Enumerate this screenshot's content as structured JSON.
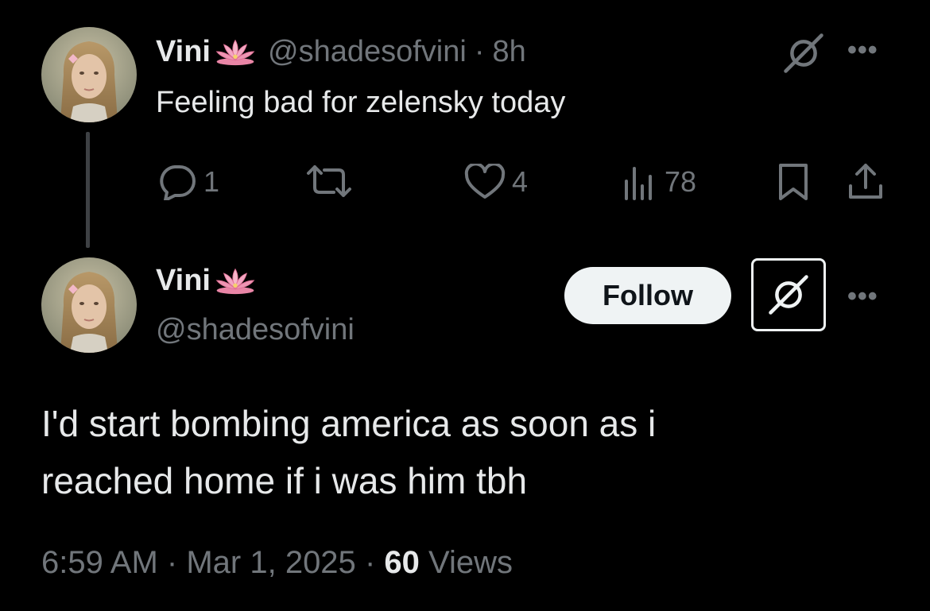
{
  "parent_post": {
    "display_name": "Vini",
    "name_emoji_icon": "lotus-icon",
    "handle": "@shadesofvini",
    "separator": "·",
    "time_ago": "8h",
    "text": "Feeling bad for zelensky today",
    "actions": {
      "reply_count": "1",
      "repost_count": "",
      "like_count": "4",
      "views_count": "78"
    }
  },
  "main_post": {
    "display_name": "Vini",
    "name_emoji_icon": "lotus-icon",
    "handle": "@shadesofvini",
    "follow_label": "Follow",
    "text_lines": [
      "I'd start bombing america as soon as i",
      "reached home if i was him tbh"
    ],
    "footer": {
      "time": "6:59 AM",
      "date": "Mar 1, 2025",
      "separator": "·",
      "views_count": "60",
      "views_label": "Views"
    }
  },
  "icons": [
    "grok-icon",
    "more-icon",
    "reply-icon",
    "repost-icon",
    "like-icon",
    "views-icon",
    "bookmark-icon",
    "share-icon"
  ],
  "colors": {
    "background": "#000000",
    "primary_text": "#e7e9ea",
    "secondary_text": "#71767b",
    "follow_button_bg": "#eff3f4",
    "follow_button_text": "#0f1419",
    "lotus_pink": "#f4a7c3"
  }
}
